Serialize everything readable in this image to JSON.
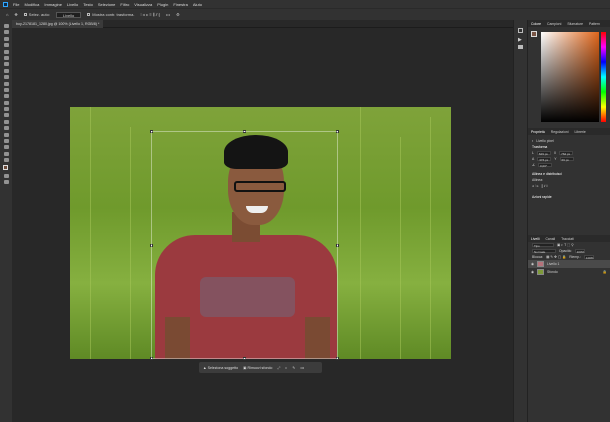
{
  "menu": [
    "File",
    "Modifica",
    "Immagine",
    "Livello",
    "Testo",
    "Selezione",
    "Filtro",
    "Visualizza",
    "Plugin",
    "Finestra",
    "Aiuto"
  ],
  "options": {
    "auto_select": "Selez. auto:",
    "auto_select_value": "Livello",
    "show_transform": "Mostra contr. trasforma.",
    "more": "•••"
  },
  "document_tab": "boy-2178181_1280.jpg @ 100% (Livello 1, RGB/8) *",
  "color_panel": {
    "tabs": [
      "Colore",
      "Campioni",
      "Sfumature",
      "Pattern"
    ],
    "accent": "#e0661b"
  },
  "properties_panel": {
    "tabs": [
      "Proprietà",
      "Regolazioni",
      "Librerie"
    ],
    "layer_type": "Livello pixel",
    "transform_title": "Trasforma",
    "fields": {
      "w": "629 px",
      "h": "376 px",
      "x": "762 px",
      "y": "66 px",
      "angle": "0,00°"
    },
    "align_title": "Allinea e distribuisci",
    "align_label": "Allinea:",
    "quick_actions": "Azioni rapide"
  },
  "layers_panel": {
    "tabs": [
      "Livelli",
      "Canali",
      "Tracciati"
    ],
    "kind": "Tipo",
    "blend_mode": "Normale",
    "opacity_label": "Opacità:",
    "opacity": "100%",
    "lock_label": "Blocca:",
    "fill_label": "Riemp.:",
    "fill": "100%",
    "layers": [
      {
        "name": "Livello 1",
        "selected": true
      },
      {
        "name": "Sfondo",
        "selected": false
      }
    ]
  },
  "context_bar": {
    "select_subject": "Seleziona soggetto",
    "remove_bg": "Rimuovi sfondo",
    "more": "•••"
  }
}
